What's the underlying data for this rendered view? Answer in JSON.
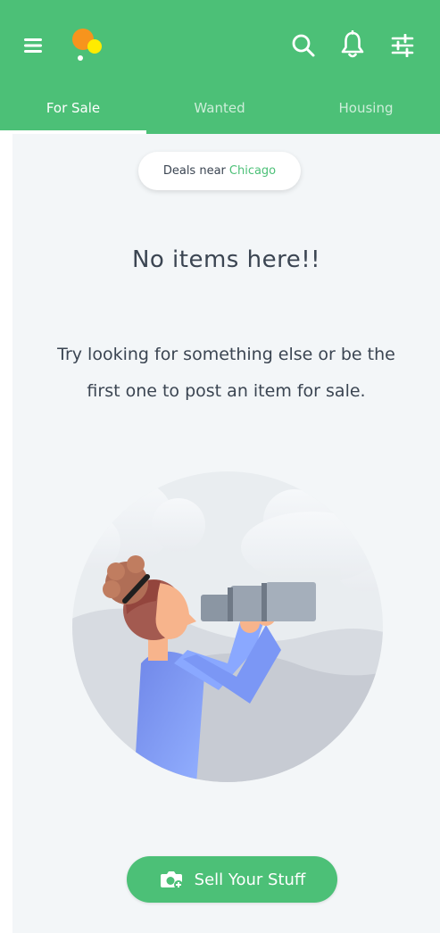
{
  "header": {
    "menu_icon": "hamburger-menu-icon",
    "logo_icon": "app-logo-dots",
    "search_icon": "search-icon",
    "notifications_icon": "bell-icon",
    "filter_icon": "sliders-filter-icon",
    "background_color": "#4cc077"
  },
  "tabs": [
    {
      "label": "For Sale",
      "active": true
    },
    {
      "label": "Wanted",
      "active": false
    },
    {
      "label": "Housing",
      "active": false
    }
  ],
  "location_pill": {
    "prefix": "Deals near",
    "city": "Chicago",
    "city_color": "#4cc077"
  },
  "empty_state": {
    "title": "No items here!!",
    "line1": "Try looking for something else or be the",
    "line2": "first one to post an item for sale.",
    "illustration": "person-with-binoculars"
  },
  "cta": {
    "label": "Sell Your Stuff",
    "icon": "camera-plus-icon",
    "color": "#4cc077"
  }
}
